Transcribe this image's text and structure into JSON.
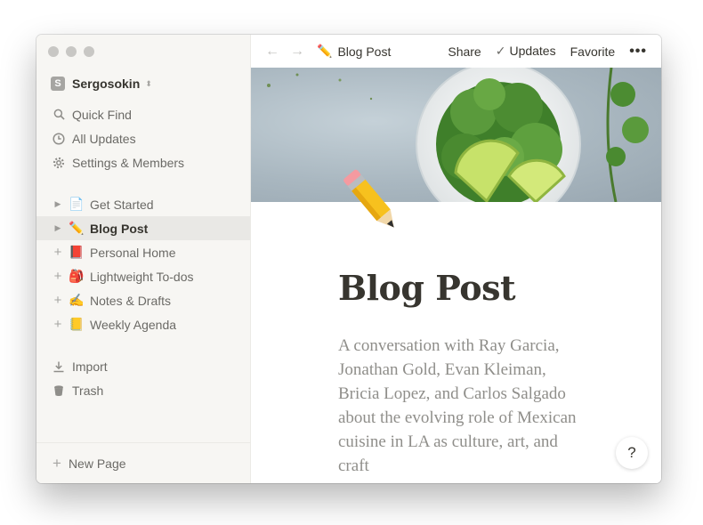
{
  "sidebar": {
    "workspace": {
      "initial": "S",
      "name": "Sergosokin"
    },
    "menu": [
      {
        "label": "Quick Find",
        "icon": "search-icon"
      },
      {
        "label": "All Updates",
        "icon": "clock-icon"
      },
      {
        "label": "Settings & Members",
        "icon": "gear-icon"
      }
    ],
    "pages": [
      {
        "label": "Get Started",
        "emoji": "📄"
      },
      {
        "label": "Blog Post",
        "emoji": "✏️"
      },
      {
        "label": "Personal Home",
        "emoji": "📕"
      },
      {
        "label": "Lightweight To-dos",
        "emoji": "🎒"
      },
      {
        "label": "Notes & Drafts",
        "emoji": "✍️"
      },
      {
        "label": "Weekly Agenda",
        "emoji": "📒"
      }
    ],
    "bottom": [
      {
        "label": "Import",
        "icon": "download-icon"
      },
      {
        "label": "Trash",
        "icon": "trash-icon"
      }
    ],
    "new_page": "New Page"
  },
  "topbar": {
    "breadcrumb_emoji": "✏️",
    "breadcrumb": "Blog Post",
    "share": "Share",
    "updates": "Updates",
    "favorite": "Favorite",
    "more": "•••"
  },
  "page": {
    "icon": "✏️",
    "title": "Blog Post",
    "description": "A conversation with Ray Garcia, Jonathan Gold, Evan Kleiman, Bricia Lopez, and Carlos Salgado about the evolving role of Mexican cuisine in LA as culture, art, and craft"
  },
  "help": "?",
  "colors": {
    "sidebar_bg": "#f7f6f3",
    "active_bg": "#e9e8e5",
    "text": "#37352f",
    "muted": "#6b6a66"
  }
}
